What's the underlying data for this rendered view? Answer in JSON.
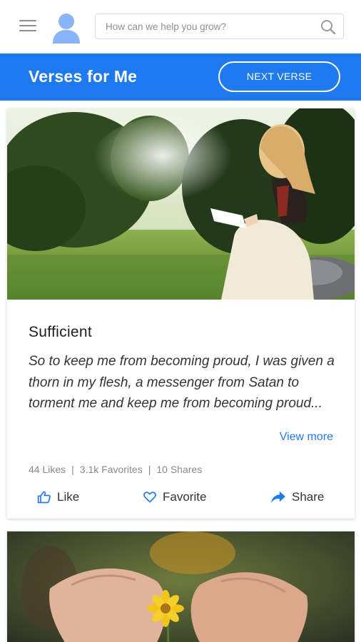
{
  "header": {
    "menu_icon": "hamburger-menu-icon",
    "avatar_icon": "user-avatar-icon",
    "search": {
      "placeholder": "How can we help you grow?",
      "icon": "search-icon"
    }
  },
  "banner": {
    "title": "Verses for Me",
    "next_label": "NEXT VERSE"
  },
  "cards": [
    {
      "title": "Sufficient",
      "text": "So to keep me from becoming proud, I was given a thorn in my flesh, a messenger from Satan to torment me and keep me from becoming proud...",
      "view_more": "View more",
      "stats": {
        "likes": "44 Likes",
        "favorites": "3.1k Favorites",
        "shares": "10 Shares",
        "separator": "|"
      },
      "actions": {
        "like": "Like",
        "favorite": "Favorite",
        "share": "Share"
      }
    }
  ],
  "colors": {
    "accent": "#1f7af0",
    "link": "#1f7af0"
  }
}
